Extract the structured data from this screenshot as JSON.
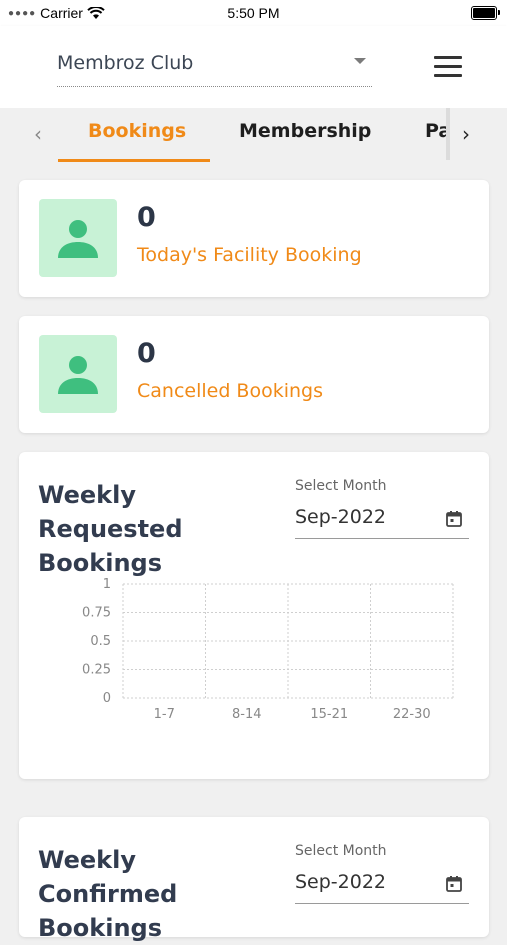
{
  "status_bar": {
    "carrier": "Carrier",
    "time": "5:50 PM"
  },
  "header": {
    "club_name": "Membroz Club"
  },
  "tabs": [
    {
      "label": "Bookings",
      "active": true
    },
    {
      "label": "Membership",
      "active": false
    },
    {
      "label": "Pa",
      "active": false
    }
  ],
  "stats": [
    {
      "value": "0",
      "label": "Today's Facility Booking"
    },
    {
      "value": "0",
      "label": "Cancelled Bookings"
    }
  ],
  "weekly_requested": {
    "title": "Weekly Requested Bookings",
    "select_label": "Select Month",
    "month_value": "Sep-2022"
  },
  "weekly_confirmed": {
    "title": "Weekly Confirmed Bookings",
    "select_label": "Select Month",
    "month_value": "Sep-2022"
  },
  "colors": {
    "accent": "#f08a18",
    "icon_bg": "#c8f2d6",
    "icon_fg": "#3fbf7f"
  },
  "chart_data": {
    "type": "line",
    "categories": [
      "1-7",
      "8-14",
      "15-21",
      "22-30"
    ],
    "series": [
      {
        "values": []
      }
    ],
    "y_ticks": [
      "1",
      "0.75",
      "0.5",
      "0.25",
      "0"
    ],
    "ylim": [
      0,
      1
    ],
    "grid": true
  }
}
